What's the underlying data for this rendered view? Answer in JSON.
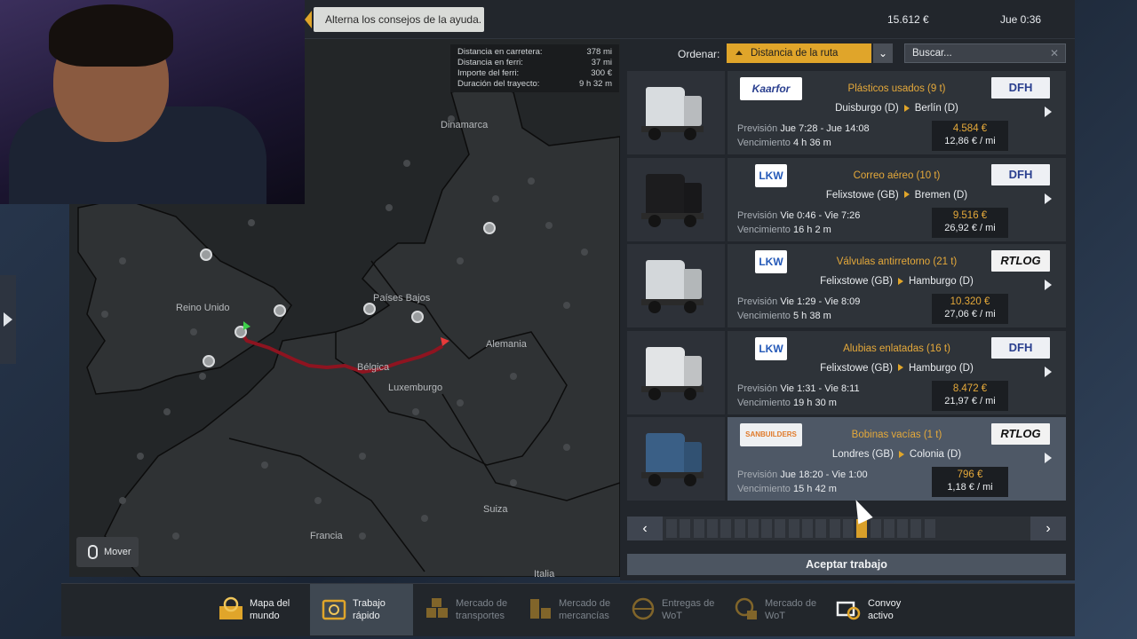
{
  "hud": {
    "tip": "Alterna los consejos de la ayuda.",
    "money": "15.612 €",
    "time": "Jue 0:36"
  },
  "map": {
    "info": [
      {
        "label": "Distancia en carretera:",
        "value": "378 mi"
      },
      {
        "label": "Distancia en ferri:",
        "value": "37 mi"
      },
      {
        "label": "Importe del ferri:",
        "value": "300 €"
      },
      {
        "label": "Duración del trayecto:",
        "value": "9 h 32 m"
      }
    ],
    "labels": {
      "dinamarca": "Dinamarca",
      "paises_bajos": "Países Bajos",
      "reino_unido": "Reino Unido",
      "alemania": "Alemania",
      "belgica": "Bélgica",
      "luxemburgo": "Luxemburgo",
      "suiza": "Suiza",
      "francia": "Francia",
      "italia": "Italia"
    },
    "move": "Mover",
    "colors": {
      "route": "#8e1420",
      "land": "#303335",
      "sea": "#232628"
    }
  },
  "sort": {
    "label": "Ordenar:",
    "selected": "Distancia de la ruta"
  },
  "search": {
    "placeholder": "Buscar..."
  },
  "jobs": [
    {
      "company": "Kaarfor",
      "cargo": "Plásticos usados (9 t)",
      "from": "Duisburgo (D)",
      "to": "Berlín (D)",
      "prevision_label": "Previsión",
      "prevision": "Jue 7:28 - Jue 14:08",
      "venc_label": "Vencimiento",
      "venc": "4 h 36 m",
      "price": "4.584 €",
      "rate": "12,86 € / mi",
      "carrier": "DFH",
      "truck_color": "#d8dcdf"
    },
    {
      "company": "LKW",
      "cargo": "Correo aéreo (10 t)",
      "from": "Felixstowe (GB)",
      "to": "Bremen (D)",
      "prevision_label": "Previsión",
      "prevision": "Vie 0:46 - Vie 7:26",
      "venc_label": "Vencimiento",
      "venc": "16 h 2 m",
      "price": "9.516 €",
      "rate": "26,92 € / mi",
      "carrier": "DFH",
      "truck_color": "#1c1c1e"
    },
    {
      "company": "LKW",
      "cargo": "Válvulas antirretorno (21 t)",
      "from": "Felixstowe (GB)",
      "to": "Hamburgo (D)",
      "prevision_label": "Previsión",
      "prevision": "Vie 1:29 - Vie 8:09",
      "venc_label": "Vencimiento",
      "venc": "5 h 38 m",
      "price": "10.320 €",
      "rate": "27,06 € / mi",
      "carrier": "RTLOG",
      "truck_color": "#d3d7da"
    },
    {
      "company": "LKW",
      "cargo": "Alubias enlatadas (16 t)",
      "from": "Felixstowe (GB)",
      "to": "Hamburgo (D)",
      "prevision_label": "Previsión",
      "prevision": "Vie 1:31 - Vie 8:11",
      "venc_label": "Vencimiento",
      "venc": "19 h 30 m",
      "price": "8.472 €",
      "rate": "21,97 € / mi",
      "carrier": "DFH",
      "truck_color": "#e2e4e6"
    },
    {
      "company": "SANBUILDERS",
      "cargo": "Bobinas vacías (1 t)",
      "from": "Londres (GB)",
      "to": "Colonia (D)",
      "prevision_label": "Previsión",
      "prevision": "Jue 18:20 - Vie 1:00",
      "venc_label": "Vencimiento",
      "venc": "15 h 42 m",
      "price": "796 €",
      "rate": "1,18 € / mi",
      "carrier": "RTLOG",
      "truck_color": "#3a5f86"
    }
  ],
  "pager": {
    "total": 20,
    "current": 15
  },
  "accept": "Aceptar trabajo",
  "tabs": [
    {
      "l1": "Mapa del",
      "l2": "mundo",
      "icon": "world-map-icon",
      "state": "normal"
    },
    {
      "l1": "Trabajo",
      "l2": "rápido",
      "icon": "quick-job-icon",
      "state": "active"
    },
    {
      "l1": "Mercado de",
      "l2": "transportes",
      "icon": "freight-market-icon",
      "state": "dim"
    },
    {
      "l1": "Mercado de",
      "l2": "mercancías",
      "icon": "cargo-market-icon",
      "state": "dim"
    },
    {
      "l1": "Entregas de",
      "l2": "WoT",
      "icon": "wot-deliveries-icon",
      "state": "dim"
    },
    {
      "l1": "Mercado de",
      "l2": "WoT",
      "icon": "wot-market-icon",
      "state": "dim"
    },
    {
      "l1": "Convoy",
      "l2": "activo",
      "icon": "convoy-icon",
      "state": "normal"
    }
  ]
}
